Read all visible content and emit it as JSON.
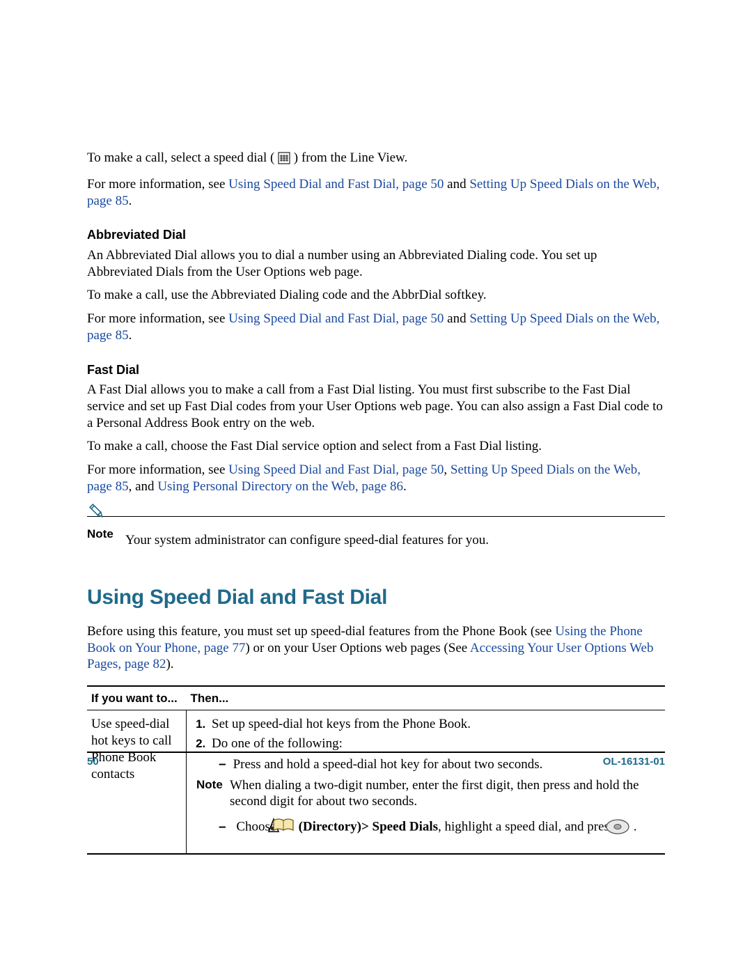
{
  "intro": {
    "line1_pre": "To make a call, select a speed dial ( ",
    "line1_post": " ) from the Line View.",
    "line2_pre": "For more information, see ",
    "link_speed": "Using Speed Dial and Fast Dial, page 50",
    "line2_mid": " and ",
    "link_web": "Setting Up Speed Dials on the Web, page 85",
    "line2_post": "."
  },
  "abbrev": {
    "heading": "Abbreviated Dial",
    "p1": "An Abbreviated Dial allows you to dial a number using an Abbreviated Dialing code. You set up Abbreviated Dials from the User Options web page.",
    "p2": "To make a call, use the Abbreviated Dialing code and the AbbrDial softkey.",
    "p3_pre": "For more information, see ",
    "p3_mid": " and ",
    "p3_post": "."
  },
  "fast": {
    "heading": "Fast Dial",
    "p1": "A Fast Dial allows you to make a call from a Fast Dial listing. You must first subscribe to the Fast Dial service and set up Fast Dial codes from your User Options web page. You can also assign a Fast Dial code to a Personal Address Book entry on the web.",
    "p2": "To make a call, choose the Fast Dial service option and select from a Fast Dial listing.",
    "p3_pre": "For more information, see ",
    "p3_sep1": ", ",
    "p3_sep2": ", and ",
    "link_personal": "Using Personal Directory on the Web, page 86",
    "p3_post": "."
  },
  "note": {
    "label": "Note",
    "text": "Your system administrator can configure speed-dial features for you."
  },
  "main": {
    "heading": "Using Speed Dial and Fast Dial",
    "intro_pre": "Before using this feature, you must set up speed-dial features from the Phone Book (see ",
    "link_phonebook": "Using the Phone Book on Your Phone, page 77",
    "intro_mid": ") or on your User Options web pages (See ",
    "link_access": "Accessing Your User Options Web Pages, page 82",
    "intro_post": ")."
  },
  "table": {
    "col1_header": "If you want to...",
    "col2_header": "Then...",
    "row1_col1": "Use speed-dial hot keys to call Phone Book contacts",
    "step1": "Set up speed-dial hot keys from the Phone Book.",
    "step2": "Do one of the following:",
    "bullet1": "Press and hold a speed-dial hot key for about two seconds.",
    "note_label": "Note",
    "note_text": "When dialing a two-digit number, enter the first digit, then press and hold the second digit for about two seconds.",
    "bullet2_pre": "Choose ",
    "bullet2_dir": "(Directory)> Speed Dials",
    "bullet2_mid": ", highlight a speed dial, and press ",
    "bullet2_post": "."
  },
  "footer": {
    "page": "50",
    "doc": "OL-16131-01"
  }
}
